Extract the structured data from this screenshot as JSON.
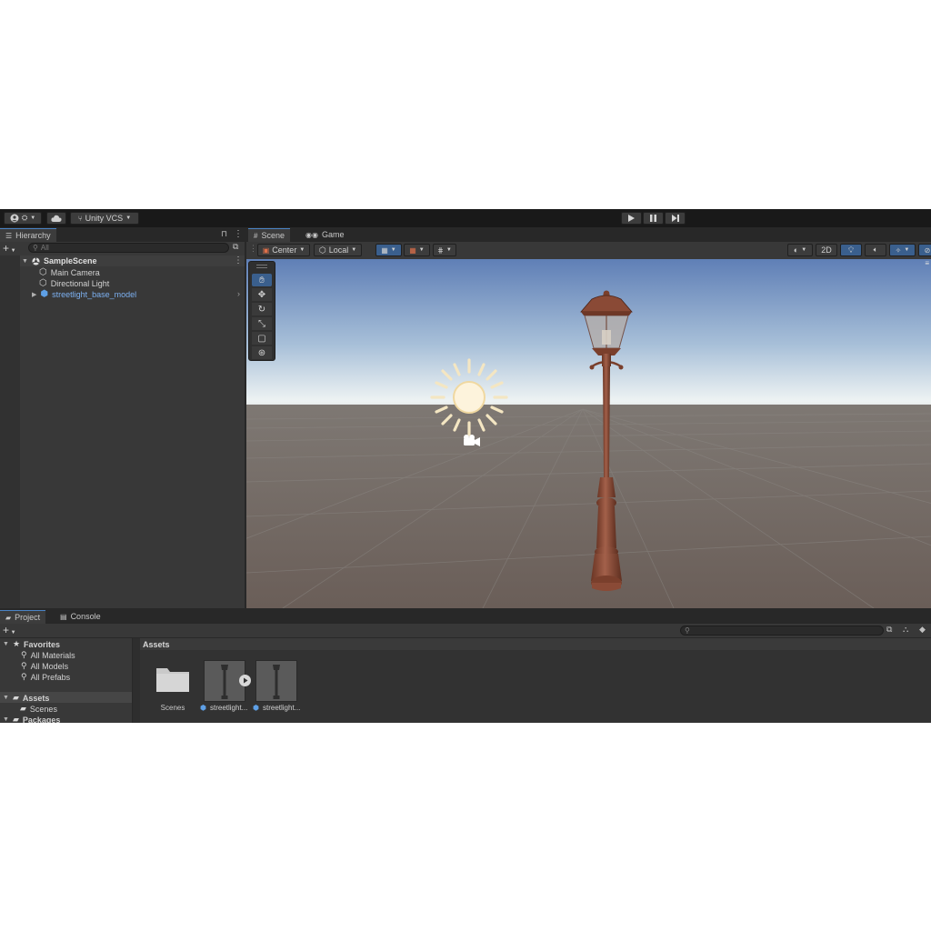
{
  "toolbar": {
    "account_icon": "account-circle-icon",
    "cloud_icon": "cloud-icon",
    "vcs_label": "Unity VCS",
    "play_icon": "play-icon",
    "pause_icon": "pause-icon",
    "step_icon": "step-icon"
  },
  "hierarchy": {
    "tab_label": "Hierarchy",
    "search_placeholder": "All",
    "scene_name": "SampleScene",
    "items": [
      {
        "label": "Main Camera"
      },
      {
        "label": "Directional Light"
      },
      {
        "label": "streetlight_base_model"
      }
    ]
  },
  "scene_tabs": {
    "scene": "Scene",
    "game": "Game"
  },
  "scene_toolbar": {
    "pivot": "Center",
    "space": "Local",
    "mode_2d": "2D"
  },
  "tools": [
    "hand-tool-icon",
    "move-tool-icon",
    "rotate-tool-icon",
    "scale-tool-icon",
    "rect-tool-icon",
    "transform-tool-icon"
  ],
  "bottom_tabs": {
    "project": "Project",
    "console": "Console"
  },
  "project": {
    "favorites_label": "Favorites",
    "favorites": [
      {
        "label": "All Materials"
      },
      {
        "label": "All Models"
      },
      {
        "label": "All Prefabs"
      }
    ],
    "assets_label": "Assets",
    "scenes_label": "Scenes",
    "packages_label": "Packages",
    "breadcrumb": "Assets",
    "grid": [
      {
        "label": "Scenes"
      },
      {
        "label": "streetlight..."
      },
      {
        "label": "streetlight..."
      }
    ]
  },
  "colors": {
    "accent": "#4a83c5",
    "selected_text": "#7cb0f0",
    "panel_bg": "#383838",
    "sky_top": "#5f7fb6",
    "ground": "#6d625d",
    "lamp": "#8a4a36"
  }
}
